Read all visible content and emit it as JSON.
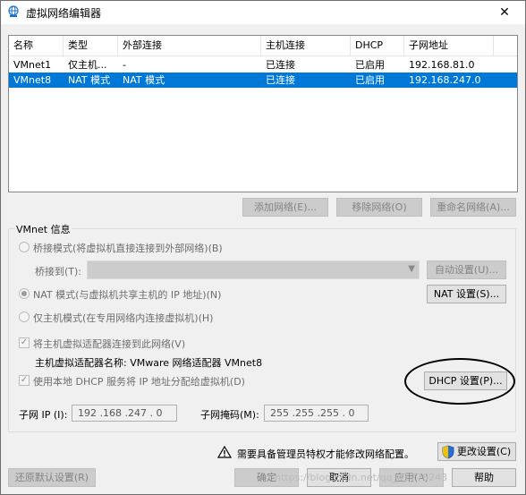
{
  "window": {
    "title": "虚拟网络编辑器",
    "close": "✕"
  },
  "table": {
    "columns": [
      "名称",
      "类型",
      "外部连接",
      "主机连接",
      "DHCP",
      "子网地址"
    ],
    "rows": [
      [
        "VMnet1",
        "仅主机...",
        "-",
        "已连接",
        "已启用",
        "192.168.81.0"
      ],
      [
        "VMnet8",
        "NAT 模式",
        "NAT 模式",
        "已连接",
        "已启用",
        "192.168.247.0"
      ]
    ],
    "selected_row": 1
  },
  "list_buttons": {
    "add": "添加网络(E)...",
    "remove": "移除网络(O)",
    "rename": "重命名网络(A)..."
  },
  "vmnet_info": {
    "title": "VMnet 信息",
    "bridge_mode": "桥接模式(将虚拟机直接连接到外部网络)(B)",
    "bridge_to_label": "桥接到(T):",
    "auto_settings": "自动设置(U)...",
    "nat_mode": "NAT 模式(与虚拟机共享主机的 IP 地址)(N)",
    "nat_settings": "NAT 设置(S)...",
    "host_only": "仅主机模式(在专用网络内连接虚拟机)(H)",
    "connect_adapter": "将主机虚拟适配器连接到此网络(V)",
    "adapter_name": "主机虚拟适配器名称: VMware 网络适配器 VMnet8",
    "use_dhcp": "使用本地 DHCP 服务将 IP 地址分配给虚拟机(D)",
    "dhcp_settings": "DHCP 设置(P)...",
    "subnet_ip_label": "子网 IP (I):",
    "subnet_ip": "192 .168 .247 . 0",
    "subnet_mask_label": "子网掩码(M):",
    "subnet_mask": "255 .255 .255 . 0",
    "selected_mode": "nat",
    "connect_adapter_checked": true,
    "use_dhcp_checked": true
  },
  "admin_notice": "需要具备管理员特权才能修改网络配置。",
  "change_settings": "更改设置(C)",
  "footer": {
    "restore_defaults": "还原默认设置(R)",
    "ok": "确定",
    "cancel": "取消",
    "apply": "应用(A)",
    "help": "帮助"
  },
  "watermark": "https://blog.csdn.net/qq_41776243"
}
